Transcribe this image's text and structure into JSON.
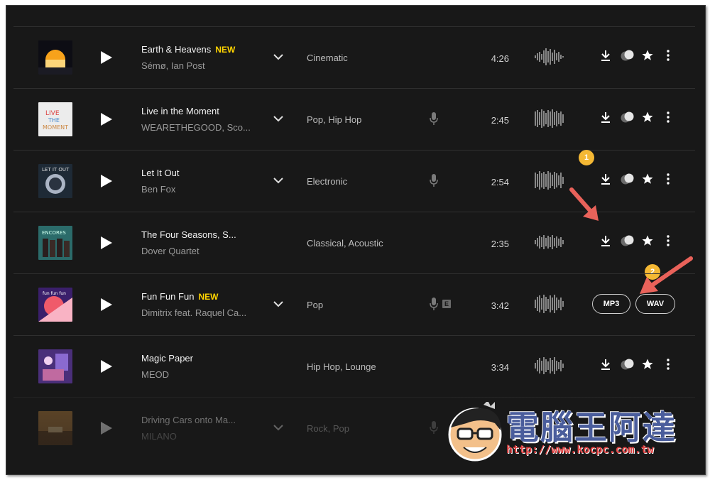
{
  "tracks": [
    {
      "title": "Earth & Heavens",
      "badge": "NEW",
      "artist": "Sémø, Ian Post",
      "genres": "Cinematic",
      "duration": "4:26",
      "mic": false,
      "explicit": false,
      "chevron": true
    },
    {
      "title": "Live in the Moment",
      "badge": "",
      "artist": "WEARETHEGOOD, Sco...",
      "genres": "Pop,  Hip Hop",
      "duration": "2:45",
      "mic": true,
      "explicit": false,
      "chevron": true
    },
    {
      "title": "Let It Out",
      "badge": "",
      "artist": "Ben Fox",
      "genres": "Electronic",
      "duration": "2:54",
      "mic": true,
      "explicit": false,
      "chevron": true
    },
    {
      "title": "The Four Seasons, S...",
      "badge": "",
      "artist": "Dover Quartet",
      "genres": "Classical,  Acoustic",
      "duration": "2:35",
      "mic": false,
      "explicit": false,
      "chevron": false
    },
    {
      "title": "Fun Fun Fun",
      "badge": "NEW",
      "artist": "Dimitrix feat. Raquel Ca...",
      "genres": "Pop",
      "duration": "3:42",
      "mic": true,
      "explicit": true,
      "chevron": true
    },
    {
      "title": "Magic Paper",
      "badge": "",
      "artist": "MEOD",
      "genres": "Hip Hop,  Lounge",
      "duration": "3:34",
      "mic": false,
      "explicit": false,
      "chevron": false
    },
    {
      "title": "Driving Cars onto Ma...",
      "badge": "",
      "artist": "MILANO",
      "genres": "Rock,  Pop",
      "duration": "",
      "mic": true,
      "explicit": false,
      "chevron": true
    }
  ],
  "formats": {
    "mp3": "MP3",
    "wav": "WAV"
  },
  "explicit_label": "E",
  "markers": {
    "one": "1",
    "two": "2"
  },
  "watermark": {
    "title": "電腦王阿達",
    "url": "http://www.kocpc.com.tw"
  },
  "colors": {
    "accent_new": "#ffd400",
    "marker": "#f4b834",
    "arrow": "#e9625a",
    "background": "#181818"
  }
}
